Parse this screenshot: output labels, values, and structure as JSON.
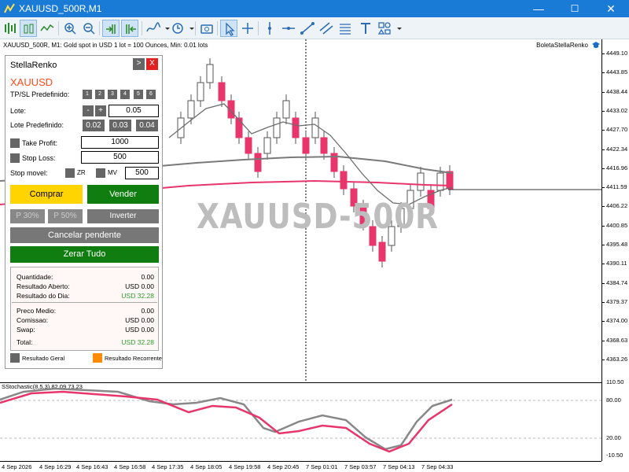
{
  "window": {
    "title": "XAUUSD_500R,M1",
    "minimize": "—",
    "maximize": "☐",
    "close": "✕"
  },
  "toolbar": {
    "icons": [
      "new-chart-icon",
      "bars-icon",
      "candles-icon",
      "line-chart-icon",
      "zoom-in-icon",
      "zoom-out-icon",
      "autoscroll-icon",
      "chart-shift-icon",
      "indicators-icon",
      "periods-icon",
      "screenshot-icon",
      "cursor-icon",
      "crosshair-icon",
      "vertical-line-icon",
      "horizontal-line-icon",
      "trendline-icon",
      "channel-icon",
      "fibonacci-icon",
      "text-icon",
      "shapes-icon"
    ]
  },
  "chart": {
    "header": "XAUUSD_500R, M1:  Gold spot in USD 1 lot = 100 Ounces, Min: 0.01 lots",
    "ea_name": "BoletaStellaRenko",
    "watermark": "XAUUSD-500R",
    "price_labels": [
      "4449.10",
      "4443.85",
      "4438.44",
      "4433.02",
      "4427.70",
      "4422.34",
      "4416.96",
      "4411.59",
      "4406.22",
      "4400.85",
      "4395.48",
      "4390.11",
      "4384.74",
      "4379.37",
      "4374.00",
      "4368.63",
      "4363.26"
    ],
    "oscillator_label": "SStochastic(8,5,3) 82.09 73.23",
    "osc_labels": [
      "110.50",
      "80.00",
      "20.00",
      "-10.50"
    ],
    "time_labels": [
      "4 Sep 2026",
      "4 Sep 16:29",
      "4 Sep 16:43",
      "4 Sep 16:58",
      "4 Sep 17:35",
      "4 Sep 18:05",
      "4 Sep 19:58",
      "4 Sep 20:45",
      "7 Sep 01:01",
      "7 Sep 03:57",
      "7 Sep 04:13",
      "7 Sep 04:33"
    ]
  },
  "panel": {
    "title": "StellaRenko",
    "min_label": ">",
    "close_label": "X",
    "symbol": "XAUUSD",
    "tpsl_label": "TP/SL Predefinido:",
    "tpsl_buttons": [
      "1",
      "2",
      "3",
      "4",
      "5",
      "6"
    ],
    "lote_label": "Lote:",
    "lote_minus": "-",
    "lote_plus": "+",
    "lote_value": "0.05",
    "lote_pre_label": "Lote Predefinido:",
    "lote_pre": [
      "0.02",
      "0.03",
      "0.04"
    ],
    "tp_label": "Take Profit:",
    "tp_value": "1000",
    "sl_label": "Stop Loss:",
    "sl_value": "500",
    "stop_movel_label": "Stop movel:",
    "zr_label": "ZR",
    "mv_label": "MV",
    "stop_movel_value": "500",
    "buy": "Comprar",
    "sell": "Vender",
    "p30": "P 30%",
    "p50": "P 50%",
    "invert": "Inverter",
    "cancel": "Cancelar pendente",
    "zerar": "Zerar Tudo",
    "info": {
      "quantidade_label": "Quantidade:",
      "quantidade": "0.00",
      "aberto_label": "Resultado Aberto:",
      "aberto": "USD 0.00",
      "dia_label": "Resultado do Dia:",
      "dia": "USD 32.28",
      "medio_label": "Preco Medio:",
      "medio": "0.00",
      "comissao_label": "Comissao:",
      "comissao": "USD 0.00",
      "swap_label": "Swap:",
      "swap": "USD 0.00",
      "total_label": "Total:",
      "total": "USD 32.28"
    },
    "legend_geral": "Resultado Geral",
    "legend_recorrente": "Resultado Recorrente",
    "colors": {
      "geral": "#666666",
      "recorrente": "#ff8c00"
    }
  }
}
